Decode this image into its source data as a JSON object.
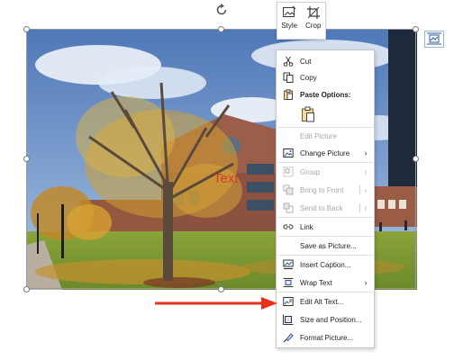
{
  "mini_toolbar": {
    "style_label": "Style",
    "crop_label": "Crop"
  },
  "picture": {
    "overlay_text": "Text"
  },
  "context_menu": {
    "cut": "Cut",
    "copy": "Copy",
    "paste_options": "Paste Options:",
    "edit_picture": "Edit Picture",
    "change_picture": "Change Picture",
    "group": "Group",
    "bring_to_front": "Bring to Front",
    "send_to_back": "Send to Back",
    "link": "Link",
    "save_as_picture": "Save as Picture...",
    "insert_caption": "Insert Caption...",
    "wrap_text": "Wrap Text",
    "edit_alt_text": "Edit Alt Text...",
    "size_and_position": "Size and Position...",
    "format_picture": "Format Picture...",
    "submenu_arrow": "›"
  },
  "colors": {
    "annotation_arrow": "#e8321e",
    "overlay_text": "#d9302c",
    "menu_text": "#1f1f1f",
    "menu_disabled_text": "#a6a6a6"
  }
}
